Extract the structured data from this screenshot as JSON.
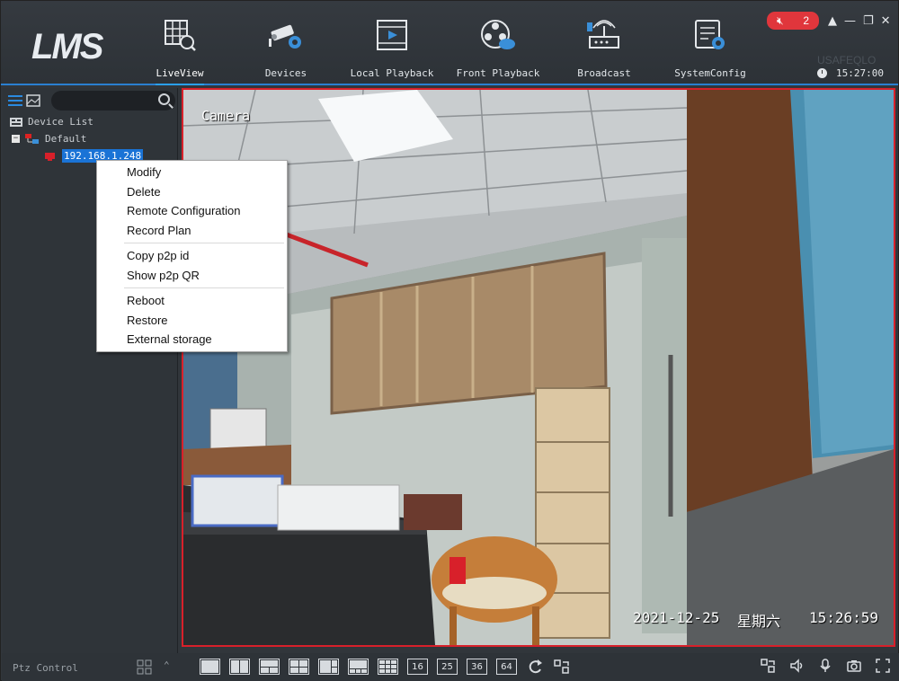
{
  "app": {
    "logo_text": "LMS"
  },
  "nav": [
    {
      "label": "LiveView",
      "icon": "grid-search-icon",
      "active": true
    },
    {
      "label": "Devices",
      "icon": "camera-gear-icon",
      "active": false
    },
    {
      "label": "Local Playback",
      "icon": "film-play-icon",
      "active": false
    },
    {
      "label": "Front Playback",
      "icon": "reel-cloud-icon",
      "active": false
    },
    {
      "label": "Broadcast",
      "icon": "radio-tower-icon",
      "active": false
    },
    {
      "label": "SystemConfig",
      "icon": "config-gear-icon",
      "active": false
    }
  ],
  "status": {
    "alarm_count": "2",
    "watermark": "USAFEQLO",
    "time": "15:27:00"
  },
  "sidebar": {
    "tree_root": "Device List",
    "group": "Default",
    "device": "192.168.1.248"
  },
  "video": {
    "osd_name": "Camera",
    "osd_date": "2021-12-25",
    "osd_weekday": "星期六",
    "osd_time": "15:26:59"
  },
  "context_menu": {
    "group1": [
      "Modify",
      "Delete",
      "Remote Configuration",
      "Record Plan"
    ],
    "group2": [
      "Copy p2p id",
      "Show p2p QR"
    ],
    "group3": [
      "Reboot",
      "Restore",
      "External storage"
    ]
  },
  "bottom": {
    "ptz_label": "Ptz Control",
    "layout_numbers": [
      "16",
      "25",
      "36",
      "64"
    ]
  }
}
